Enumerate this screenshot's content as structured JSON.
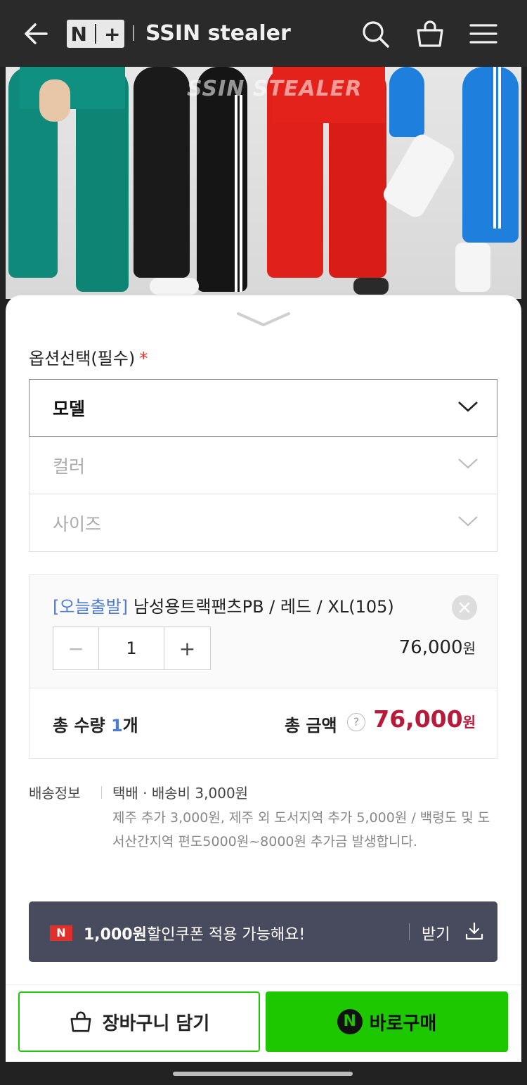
{
  "header": {
    "logo_text_left": "N",
    "logo_text_right": "+",
    "store_name": "SSIN stealer"
  },
  "hero": {
    "watermark": "SSIN STEALER"
  },
  "options": {
    "label": "옵션선택(필수)",
    "required_mark": "*",
    "selects": [
      {
        "value": "모델"
      },
      {
        "value": "컬러"
      },
      {
        "value": "사이즈"
      }
    ]
  },
  "selected_item": {
    "tag": "[오늘출발]",
    "name": "남성용트랙팬츠PB / 레드 / XL(105)",
    "quantity": "1",
    "minus": "−",
    "plus": "+",
    "price": "76,000",
    "price_unit": "원"
  },
  "totals": {
    "qty_label": "총 수량 ",
    "qty_value": "1",
    "qty_unit": "개",
    "amount_label": "총 금액",
    "help": "?",
    "amount_value": "76,000",
    "amount_unit": "원"
  },
  "shipping": {
    "label": "배송정보",
    "main": "택배 · 배송비 3,000원",
    "note": "제주 추가 3,000원, 제주 외 도서지역 추가 5,000원 / 백령도 및 도서산간지역 편도5000원~8000원 추가금 발생합니다."
  },
  "coupon": {
    "logo": "N",
    "amount": "1,000원",
    "message": "할인쿠폰 적용 가능해요!",
    "action": "받기"
  },
  "buttons": {
    "cart": "장바구니 담기",
    "buy_logo": "N",
    "buy": "바로구매"
  },
  "colors": {
    "naver_green": "#1ec800",
    "price_red": "#b81a3a",
    "tag_blue": "#4f7bd8",
    "coupon_bg": "#484a5e"
  }
}
